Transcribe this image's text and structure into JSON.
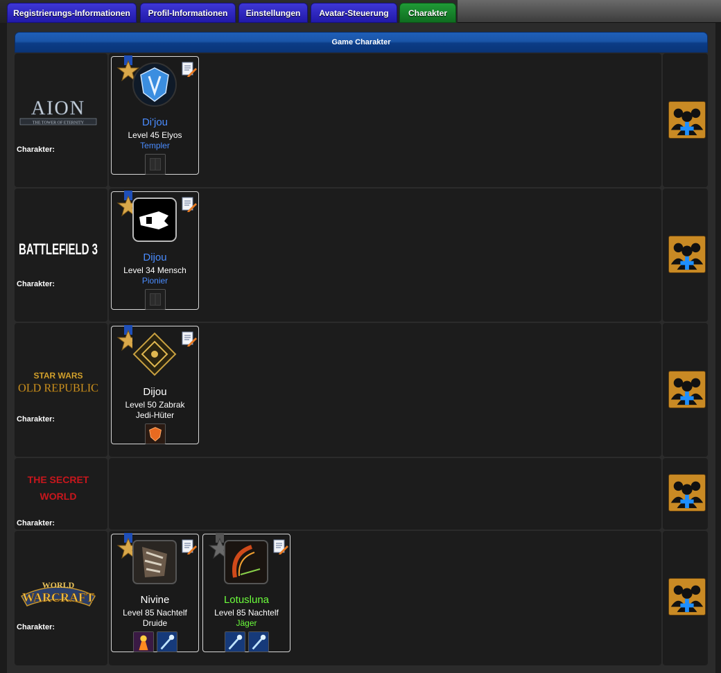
{
  "tabs": [
    {
      "label": "Registrierungs-Informationen",
      "active": false
    },
    {
      "label": "Profil-Informationen",
      "active": false
    },
    {
      "label": "Einstellungen",
      "active": false
    },
    {
      "label": "Avatar-Steuerung",
      "active": false
    },
    {
      "label": "Charakter",
      "active": true
    }
  ],
  "section_title": "Game Charakter",
  "colors": {
    "tab_blue": "#2a22c0",
    "tab_green": "#178a2c",
    "header_blue": "#1a55a8",
    "name_blue": "#4a8cff",
    "name_green": "#6cff3c"
  },
  "games": [
    {
      "logo_text": "AION",
      "logo_sub": "THE TOWER OF ETERNITY",
      "label": "Charakter:",
      "characters": [
        {
          "name": "Di'jou",
          "level": "Level 45 Elyos",
          "class": "Templer",
          "name_color": "#4a8cff",
          "class_color": "#4a8cff",
          "medal": "gold"
        }
      ]
    },
    {
      "logo_text": "BATTLEFIELD 3",
      "label": "Charakter:",
      "characters": [
        {
          "name": "Dijou",
          "level": "Level 34 Mensch",
          "class": "Pionier",
          "name_color": "#4a8cff",
          "class_color": "#4a8cff",
          "medal": "gold"
        }
      ]
    },
    {
      "logo_text": "STAR WARS",
      "logo_sub": "OLD REPUBLIC",
      "label": "Charakter:",
      "characters": [
        {
          "name": "Dijou",
          "level": "Level 50 Zabrak",
          "class": "Jedi-Hüter",
          "name_color": "#ffffff",
          "class_color": "#ffffff",
          "medal": "gold"
        }
      ]
    },
    {
      "logo_text": "THE SECRET",
      "logo_sub": "WORLD",
      "label": "Charakter:",
      "characters": []
    },
    {
      "logo_text": "WORLD",
      "logo_sub": "WARCRAFT",
      "label": "Charakter:",
      "characters": [
        {
          "name": "Nivine",
          "level": "Level 85 Nachtelf",
          "class": "Druide",
          "name_color": "#ffffff",
          "class_color": "#ffffff",
          "medal": "gold"
        },
        {
          "name": "Lotusluna",
          "level": "Level 85 Nachtelf",
          "class": "Jäger",
          "name_color": "#6cff3c",
          "class_color": "#6cff3c",
          "medal": "grey"
        }
      ]
    }
  ]
}
